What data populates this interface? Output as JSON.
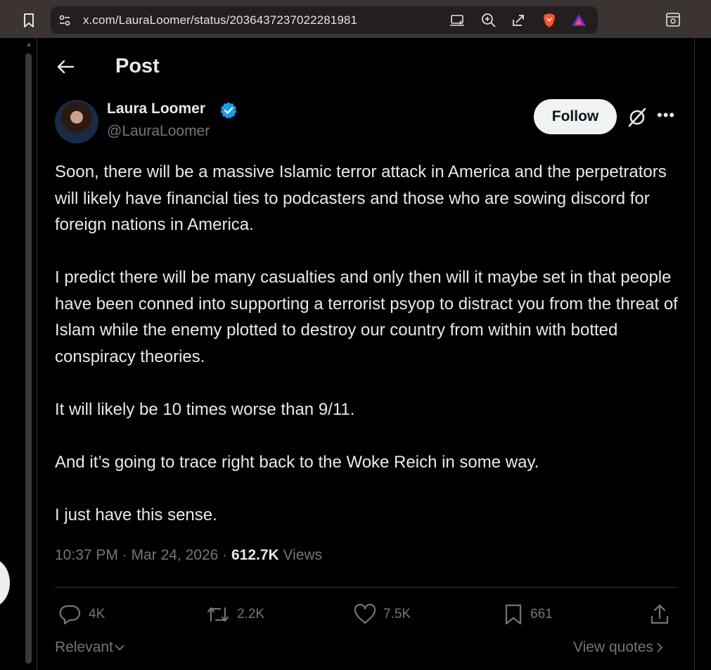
{
  "browser": {
    "url": "x.com/LauraLoomer/status/2036437237022281981",
    "icons": [
      "bookmark-icon",
      "site-settings-icon",
      "install-app-icon",
      "zoom-icon",
      "share-icon",
      "brave-shield-icon",
      "brave-rewards-icon",
      "reader-mode-icon"
    ]
  },
  "header": {
    "title": "Post"
  },
  "author": {
    "name": "Laura Loomer",
    "handle": "@LauraLoomer",
    "verified_color": "#1d9bf0"
  },
  "actions_top": {
    "follow_label": "Follow"
  },
  "post": {
    "paragraphs": [
      "Soon, there will be a massive Islamic terror attack in America and the perpetrators will likely have financial ties to podcasters and those who are sowing discord for foreign nations in America.",
      "I predict there will be many casualties and only then will it maybe set in that people have been conned into supporting a terrorist psyop to distract you from the threat of Islam while the enemy plotted to destroy our country from within with botted conspiracy theories.",
      "It will likely be 10 times worse than 9/11.",
      "And it’s going to trace right back to the Woke Reich in some way.",
      "I just have this sense."
    ],
    "time": "10:37 PM",
    "date": "Mar 24, 2026",
    "views_count": "612.7K",
    "views_label": "Views"
  },
  "engagement": {
    "replies": "4K",
    "reposts": "2.2K",
    "likes": "7.5K",
    "bookmarks": "661"
  },
  "footer": {
    "sort_label": "Relevant",
    "view_quotes_label": "View quotes"
  },
  "colors": {
    "background": "#000000",
    "text": "#e7e9ea",
    "muted": "#71767b",
    "border": "#2f3336"
  }
}
